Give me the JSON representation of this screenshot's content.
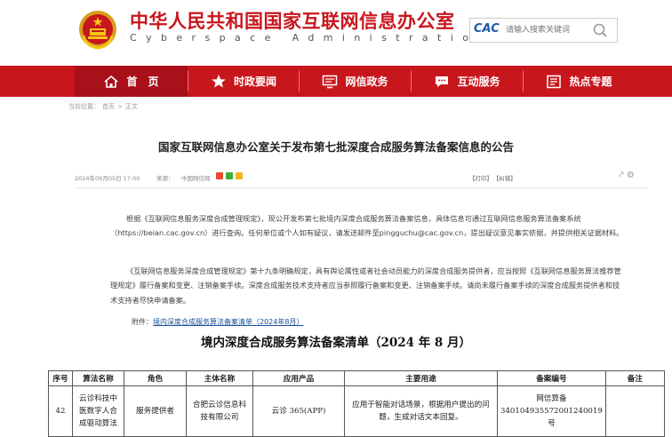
{
  "header": {
    "site_title": "中华人民共和国国家互联网信息办公室",
    "site_title_en": "Cyberspace Administration of China",
    "search_logo": "CAC",
    "search_placeholder": "请输入搜索关键词"
  },
  "nav": {
    "items": [
      {
        "label": "首　页",
        "icon": "home-icon"
      },
      {
        "label": "时政要闻",
        "icon": "star-icon"
      },
      {
        "label": "网信政务",
        "icon": "monitor-icon"
      },
      {
        "label": "互动服务",
        "icon": "chat-icon"
      },
      {
        "label": "热点专题",
        "icon": "document-icon"
      }
    ],
    "accent_color": "#c8161d"
  },
  "breadcrumb": [
    "当前位置：",
    "首页",
    ">",
    "正文"
  ],
  "article": {
    "title": "国家互联网信息办公室关于发布第七批深度合成服务算法备案信息的公告",
    "date": "2024年09月05日 17:00",
    "source_label": "来源：",
    "source": "中国网信网",
    "tools": [
      "【打印】",
      "【纠错】"
    ],
    "paragraph1": "根据《互联网信息服务深度合成管理规定》，现公开发布第七批境内深度合成服务算法备案信息，具体信息可通过互联网信息服务算法备案系统（https://beian.cac.gov.cn）进行查询。任何单位或个人如有疑议，请发送邮件至pingguchu@cac.gov.cn，提出疑议意见事实依据，并提供相关证据材料。",
    "paragraph2": "《互联网信息服务深度合成管理规定》第十九条明确规定，具有舆论属性或者社会动员能力的深度合成服务提供者，应当按照《互联网信息服务算法推荐管理规定》履行备案和变更、注销备案手续。深度合成服务技术支持者应当参照履行备案和变更、注销备案手续。请尚未履行备案手续的深度合成服务提供者和技术支持者尽快申请备案。",
    "attachment_label": "附件：",
    "attachment_link": "境内深度合成服务算法备案清单（2024年8月）"
  },
  "list_title": "境内深度合成服务算法备案清单（2024 年 8 月）",
  "table": {
    "headers": [
      "序号",
      "算法名称",
      "角色",
      "主体名称",
      "应用产品",
      "主要用途",
      "备案编号",
      "备注"
    ],
    "rows": [
      {
        "no": "42",
        "algorithm": "云诊科技中医数字人合成驱动算法",
        "role": "服务提供者",
        "entity": "合肥云诊信息科技有限公司",
        "product": "云诊 365(APP)",
        "purpose": "应用于智能对话场景，根据用户提出的问题，生成对话文本回复。",
        "record_no": "网信算备340104935572001240019号",
        "note": ""
      }
    ]
  }
}
